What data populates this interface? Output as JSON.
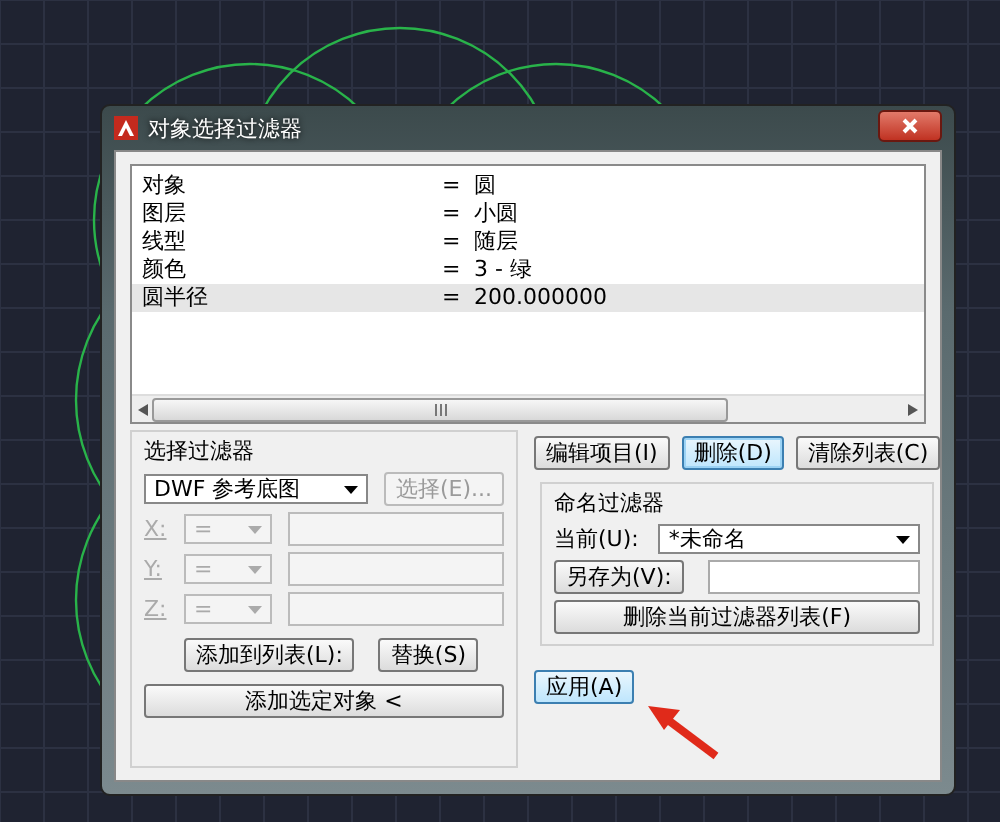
{
  "window": {
    "title": "对象选择过滤器"
  },
  "filter_list": {
    "rows": [
      {
        "property": "对象",
        "operator": "=",
        "value": "圆",
        "selected": false
      },
      {
        "property": "图层",
        "operator": "=",
        "value": "小圆",
        "selected": false
      },
      {
        "property": "线型",
        "operator": "=",
        "value": "随层",
        "selected": false
      },
      {
        "property": "颜色",
        "operator": "=",
        "value": "3 - 绿",
        "selected": false
      },
      {
        "property": "圆半径",
        "operator": "=",
        "value": "200.000000",
        "selected": true
      }
    ]
  },
  "select_filter": {
    "label": "选择过滤器",
    "dropdown": {
      "value": "DWF 参考底图"
    },
    "select_button": {
      "label": "选择(E)...",
      "disabled": true
    },
    "coords": [
      {
        "axis": "X:",
        "operator": "=",
        "disabled": true
      },
      {
        "axis": "Y:",
        "operator": "=",
        "disabled": true
      },
      {
        "axis": "Z:",
        "operator": "=",
        "disabled": true
      }
    ],
    "add_to_list_button": "添加到列表(L):",
    "replace_button": "替换(S)",
    "add_selected_button": "添加选定对象 <"
  },
  "list_buttons": [
    {
      "label": "编辑项目(I)",
      "selected": false
    },
    {
      "label": "删除(D)",
      "selected": true
    },
    {
      "label": "清除列表(C)",
      "selected": false
    }
  ],
  "named_filters": {
    "label": "命名过滤器",
    "current_label": "当前(U):",
    "current_value": "*未命名",
    "save_as_button": "另存为(V):",
    "delete_button": "删除当前过滤器列表(F)"
  },
  "apply_button": "应用(A)"
}
